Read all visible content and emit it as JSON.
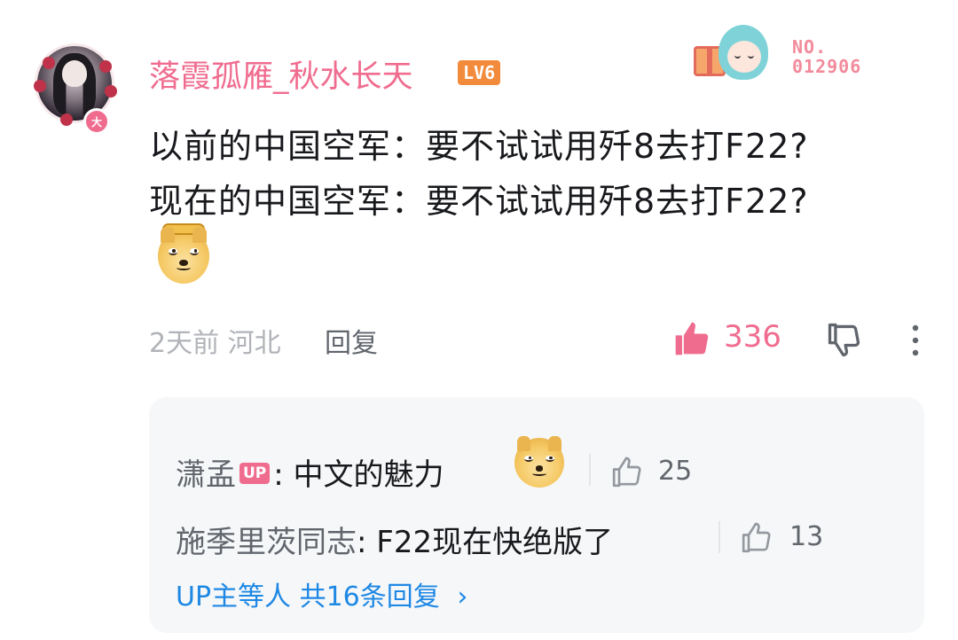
{
  "comment": {
    "username": "落霞孤雁_秋水长天",
    "level": "LV6",
    "avatar_badge": "大",
    "decoration_label": "NO.",
    "decoration_number": "012906",
    "line1": "以前的中国空军：要不试试用歼8去打F22?",
    "line2": "现在的中国空军：要不试试用歼8去打F22?",
    "time": "2天前",
    "location": "河北",
    "reply_label": "回复",
    "like_count": "336",
    "colors": {
      "accent_pink": "#f06c8f",
      "level_orange": "#f28b3c",
      "link_blue": "#1e88e5"
    }
  },
  "replies": [
    {
      "author": "潇孟",
      "up_badge": "UP",
      "separator": ":",
      "text": "中文的魅力",
      "likes": "25"
    },
    {
      "author": "施季里茨同志",
      "separator": ":",
      "text": "F22现在快绝版了",
      "likes": "13"
    }
  ],
  "replies_footer": {
    "label": "UP主等人 共16条回复",
    "chevron": "›"
  },
  "icons": {
    "like": "thumbs-up-icon",
    "dislike": "thumbs-down-icon",
    "more": "more-vertical-icon",
    "emoji": "doge-emoji"
  }
}
